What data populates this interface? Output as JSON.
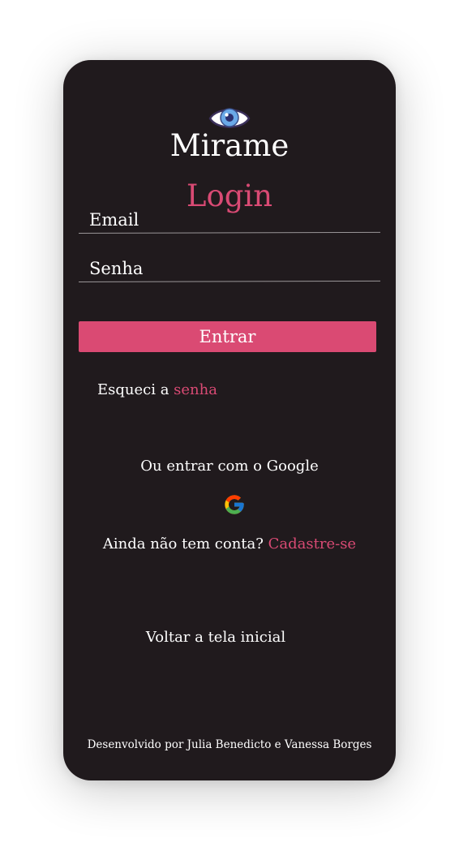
{
  "app": {
    "name": "Mirame",
    "logo_icon": "eye-icon"
  },
  "page": {
    "title": "Login"
  },
  "form": {
    "email_label": "Email",
    "password_label": "Senha",
    "submit_label": "Entrar"
  },
  "forgot": {
    "prefix": "Esqueci a ",
    "link": "senha"
  },
  "google": {
    "text": "Ou entrar com o Google",
    "icon": "google-icon"
  },
  "signup": {
    "prefix": "Ainda não tem conta? ",
    "link": "Cadastre-se"
  },
  "back_label": "Voltar a tela inicial",
  "footer": "Desenvolvido por Julia Benedicto e Vanessa Borges",
  "colors": {
    "background": "#201a1d",
    "accent": "#da4a73",
    "text": "#ffffff"
  }
}
